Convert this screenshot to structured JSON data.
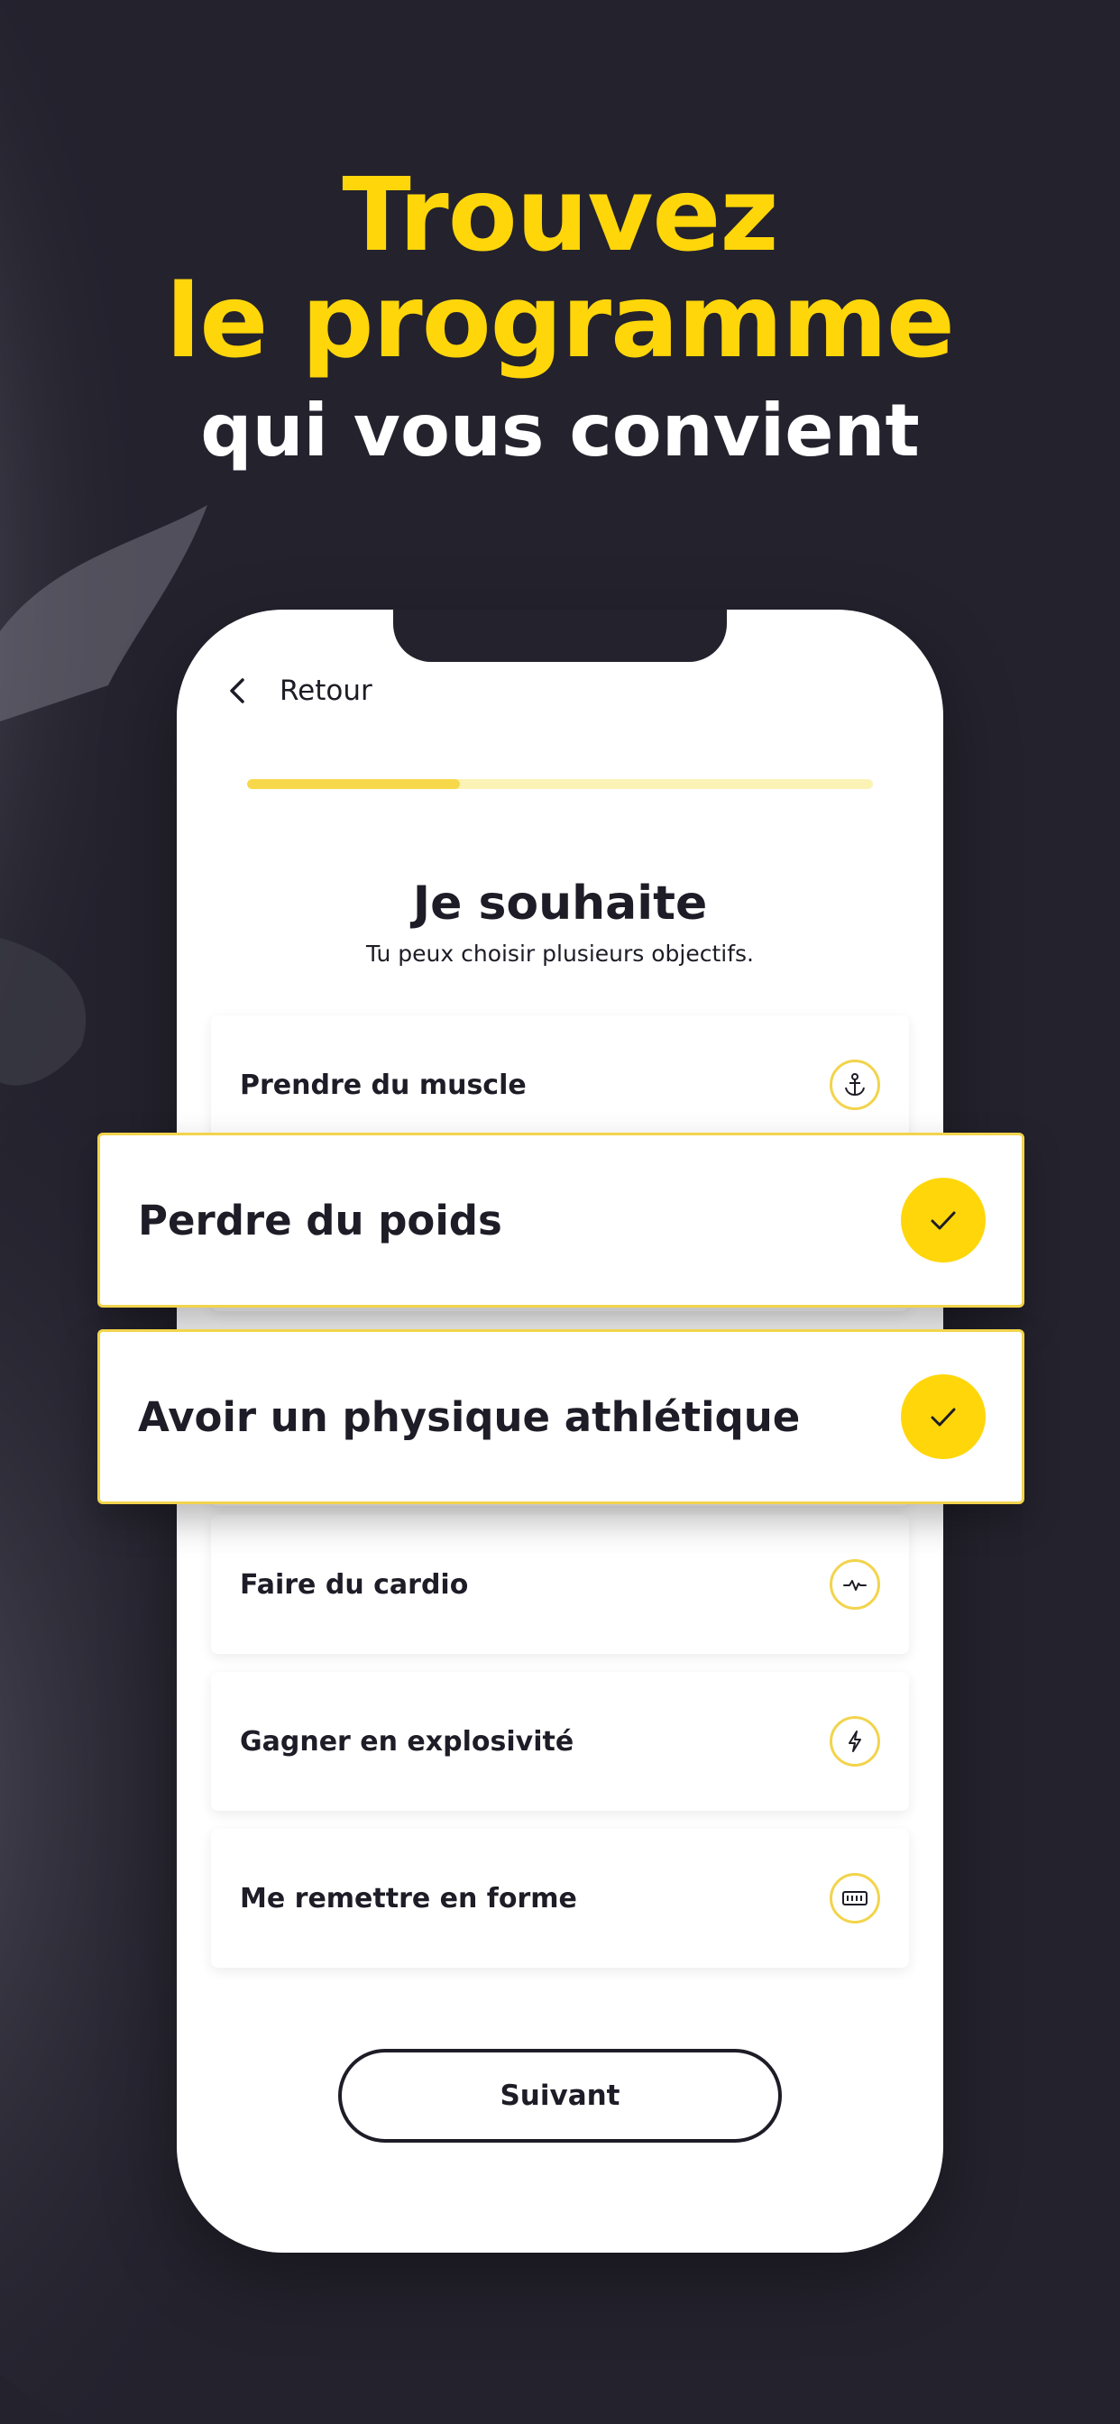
{
  "colors": {
    "background": "#24222d",
    "accent": "#ffd60a",
    "text_dark": "#1e1c26",
    "progress_track": "#fbf3b6",
    "progress_fill": "#f7d84a"
  },
  "headline": {
    "line1": "Trouvez",
    "line2": "le programme",
    "line3": "qui vous convient"
  },
  "phone": {
    "back_label": "Retour",
    "progress_fraction": 0.34,
    "title": "Je souhaite",
    "subtitle": "Tu peux choisir plusieurs objectifs.",
    "options": [
      {
        "label": "Prendre du muscle",
        "icon": "anchor-icon",
        "selected": false
      },
      {
        "label": "Perdre du poids",
        "icon": "check-icon",
        "selected": true
      },
      {
        "label": "Avoir un physique athlétique",
        "icon": "check-icon",
        "selected": true
      },
      {
        "label": "Faire du cardio",
        "icon": "heartbeat-icon",
        "selected": false
      },
      {
        "label": "Gagner en explosivité",
        "icon": "lightning-icon",
        "selected": false
      },
      {
        "label": "Me remettre en forme",
        "icon": "battery-icon",
        "selected": false
      }
    ],
    "next_label": "Suivant"
  }
}
